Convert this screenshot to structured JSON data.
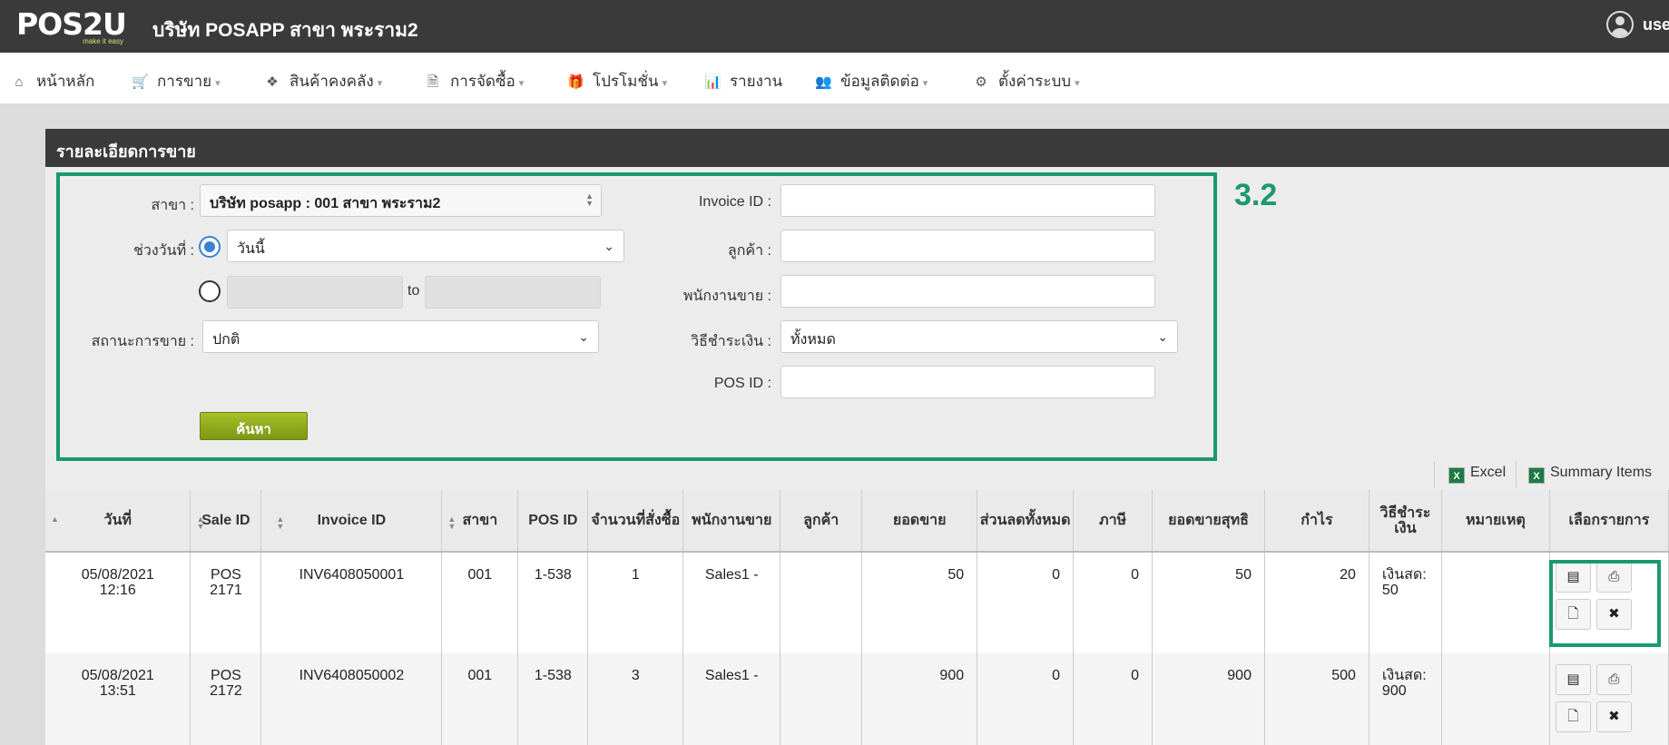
{
  "header": {
    "logo_text": "POS2U",
    "logo_tagline": "make it easy",
    "company": "บริษัท POSAPP สาขา พระราม2",
    "user_name": "use"
  },
  "nav": [
    {
      "icon": "home-icon",
      "glyph": "⌂",
      "label": "หน้าหลัก",
      "caret": false
    },
    {
      "icon": "cart-icon",
      "glyph": "🛒",
      "label": "การขาย",
      "caret": true
    },
    {
      "icon": "cubes-icon",
      "glyph": "❖",
      "label": "สินค้าคงคลัง",
      "caret": true
    },
    {
      "icon": "file-icon",
      "glyph": "🗎",
      "label": "การจัดซื้อ",
      "caret": true
    },
    {
      "icon": "gift-icon",
      "glyph": "🎁",
      "label": "โปรโมชั่น",
      "caret": true
    },
    {
      "icon": "bar-chart-icon",
      "glyph": "📊",
      "label": "รายงาน",
      "caret": false
    },
    {
      "icon": "users-icon",
      "glyph": "👥",
      "label": "ข้อมูลติดต่อ",
      "caret": true
    },
    {
      "icon": "gear-icon",
      "glyph": "⚙",
      "label": "ตั้งค่าระบบ",
      "caret": true
    }
  ],
  "panel": {
    "title": "รายละเอียดการขาย",
    "callout": "3.2"
  },
  "filters": {
    "branch_label": "สาขา :",
    "branch_value": "บริษัท posapp : 001 สาขา พระราม2",
    "date_range_label": "ช่วงวันที่ :",
    "date_preset_value": "วันนี้",
    "to_label": "to",
    "status_label": "สถานะการขาย :",
    "status_value": "ปกติ",
    "search_button": "ค้นหา",
    "invoice_label": "Invoice ID :",
    "invoice_value": "",
    "customer_label": "ลูกค้า :",
    "customer_value": "",
    "salesperson_label": "พนักงานขาย :",
    "salesperson_value": "",
    "payment_label": "วิธีชำระเงิน :",
    "payment_value": "ทั้งหมด",
    "pos_label": "POS ID :",
    "pos_value": ""
  },
  "toolbar": {
    "excel": "Excel",
    "summary": "Summary Items"
  },
  "table": {
    "headers": [
      "วันที่",
      "Sale ID",
      "Invoice ID",
      "สาขา",
      "POS ID",
      "จำนวนที่สั่งซื้อ",
      "พนักงานขาย",
      "ลูกค้า",
      "ยอดขาย",
      "ส่วนลดทั้งหมด",
      "ภาษี",
      "ยอดขายสุทธิ",
      "กำไร",
      "วิธีชำระเงิน",
      "หมายเหตุ",
      "เลือกรายการ"
    ],
    "rows": [
      {
        "date": "05/08/2021",
        "time": "12:16",
        "sale_a": "POS",
        "sale_b": "2171",
        "invoice": "INV6408050001",
        "branch": "001",
        "pos": "1-538",
        "qty": "1",
        "seller": "Sales1 -",
        "customer": "",
        "sales": "50",
        "discount": "0",
        "tax": "0",
        "net": "50",
        "profit": "20",
        "pay_a": "เงินสด:",
        "pay_b": "50",
        "note": ""
      },
      {
        "date": "05/08/2021",
        "time": "13:51",
        "sale_a": "POS",
        "sale_b": "2172",
        "invoice": "INV6408050002",
        "branch": "001",
        "pos": "1-538",
        "qty": "3",
        "seller": "Sales1 -",
        "customer": "",
        "sales": "900",
        "discount": "0",
        "tax": "0",
        "net": "900",
        "profit": "500",
        "pay_a": "เงินสด:",
        "pay_b": "900",
        "note": ""
      }
    ]
  }
}
